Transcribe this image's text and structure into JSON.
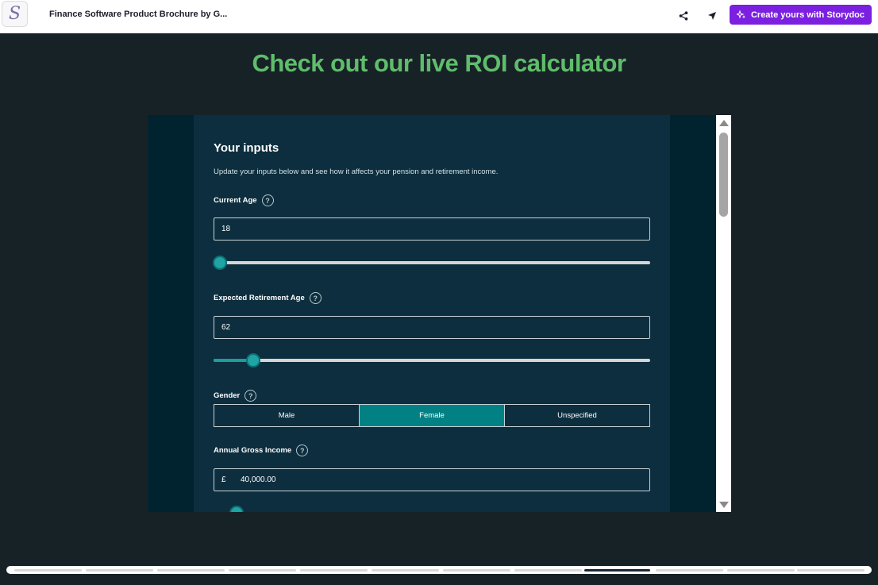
{
  "topbar": {
    "logo_letter": "S",
    "title": "Finance Software Product Brochure by G...",
    "share_icon": "share-icon",
    "send_icon": "send-icon",
    "cta_label": "Create yours with Storydoc",
    "cta_icon": "sparkle-icon"
  },
  "heading": "Check out our live ROI calculator",
  "calculator": {
    "title": "Your inputs",
    "description": "Update your inputs below and see how it affects your pension and retirement income.",
    "current_age": {
      "label": "Current Age",
      "value": "18",
      "slider_fraction": 0.0
    },
    "retirement_age": {
      "label": "Expected Retirement Age",
      "value": "62",
      "slider_fraction": 0.079
    },
    "gender": {
      "label": "Gender",
      "options": [
        "Male",
        "Female",
        "Unspecified"
      ],
      "selected": "Female"
    },
    "income": {
      "label": "Annual Gross Income",
      "currency": "£",
      "value": "40,000.00"
    },
    "help_symbol": "?"
  },
  "colors": {
    "accent_green": "#5fbd6b",
    "cta_purple": "#7b1fe0",
    "selected_teal": "#018184",
    "panel_bg": "#0d2e3e"
  }
}
